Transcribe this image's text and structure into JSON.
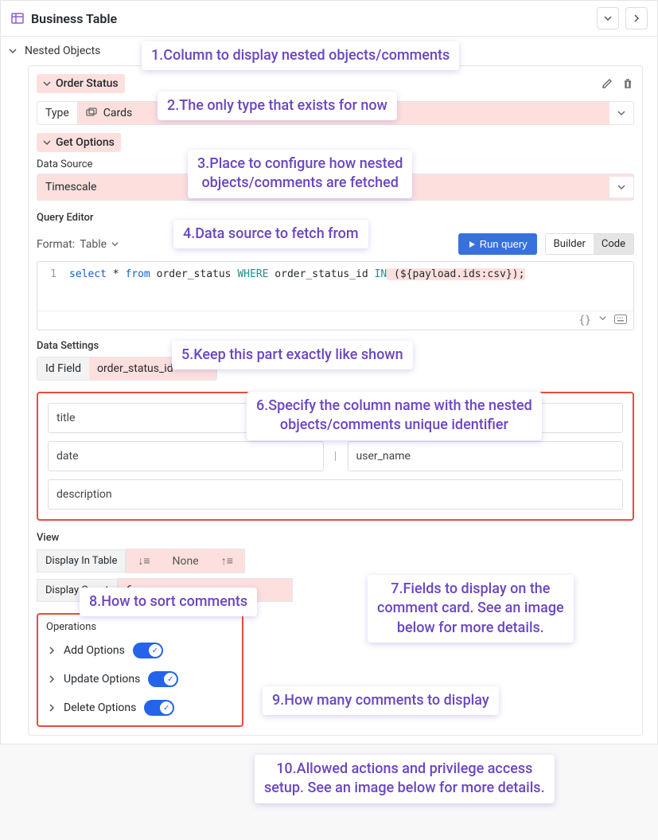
{
  "header": {
    "title": "Business Table"
  },
  "section": {
    "title": "Nested Objects"
  },
  "orderStatus": {
    "label": "Order Status"
  },
  "type": {
    "label": "Type",
    "value": "Cards"
  },
  "getOptions": {
    "label": "Get Options"
  },
  "dataSource": {
    "label": "Data Source",
    "value": "Timescale"
  },
  "queryEditor": {
    "title": "Query Editor",
    "formatLabel": "Format:",
    "formatValue": "Table",
    "run": "Run query",
    "builder": "Builder",
    "code": "Code",
    "lineNo": "1",
    "sql": {
      "p1": "select",
      "p2": " * ",
      "p3": "from",
      "p4": " order_status ",
      "p5": "WHERE",
      "p6": " order_status_id ",
      "p7": "IN",
      "p8": " (${payload.ids:csv});"
    }
  },
  "dataSettings": {
    "title": "Data Settings",
    "idFieldLabel": "Id Field",
    "idFieldValue": "order_status_id"
  },
  "fields": {
    "f1": "title",
    "f2": "date",
    "f3": "user_name",
    "f4": "description"
  },
  "view": {
    "title": "View",
    "displayInTable": "Display In Table",
    "sortNone": "None",
    "displayCountLabel": "Display Count",
    "displayCountValue": "6"
  },
  "operations": {
    "title": "Operations",
    "add": "Add Options",
    "update": "Update Options",
    "delete": "Delete Options"
  },
  "annotations": {
    "a1": "1.Column to display nested objects/comments",
    "a2": "2.The only type that exists for now",
    "a3": "3.Place to configure how nested\nobjects/comments are fetched",
    "a4": "4.Data source to fetch from",
    "a5": "5.Keep this part exactly like shown",
    "a6": "6.Specify the column name with the nested\nobjects/comments unique identifier",
    "a7": "7.Fields to display on the\ncomment card. See an image\nbelow for more details.",
    "a8": "8.How to sort comments",
    "a9": "9.How many comments to display",
    "a10": "10.Allowed actions and privilege access\nsetup. See an image below for more details."
  }
}
